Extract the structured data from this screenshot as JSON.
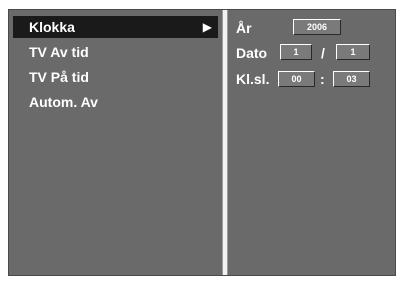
{
  "menu": {
    "items": [
      {
        "label": "Klokka",
        "selected": true,
        "arrow": "▶"
      },
      {
        "label": "TV Av tid",
        "selected": false
      },
      {
        "label": "TV På tid",
        "selected": false
      },
      {
        "label": "Autom. Av",
        "selected": false
      }
    ]
  },
  "clock": {
    "year_label": "År",
    "year_value": "2006",
    "date_label": "Dato",
    "date_day": "1",
    "date_separator": "/",
    "date_month": "1",
    "time_label": "Kl.sl.",
    "time_hours": "00",
    "time_separator": ":",
    "time_minutes": "03"
  },
  "colors": {
    "panel": "#6a6a6a",
    "selected": "#1a1a1a",
    "divider": "#f2f2f2",
    "text": "#ffffff"
  }
}
